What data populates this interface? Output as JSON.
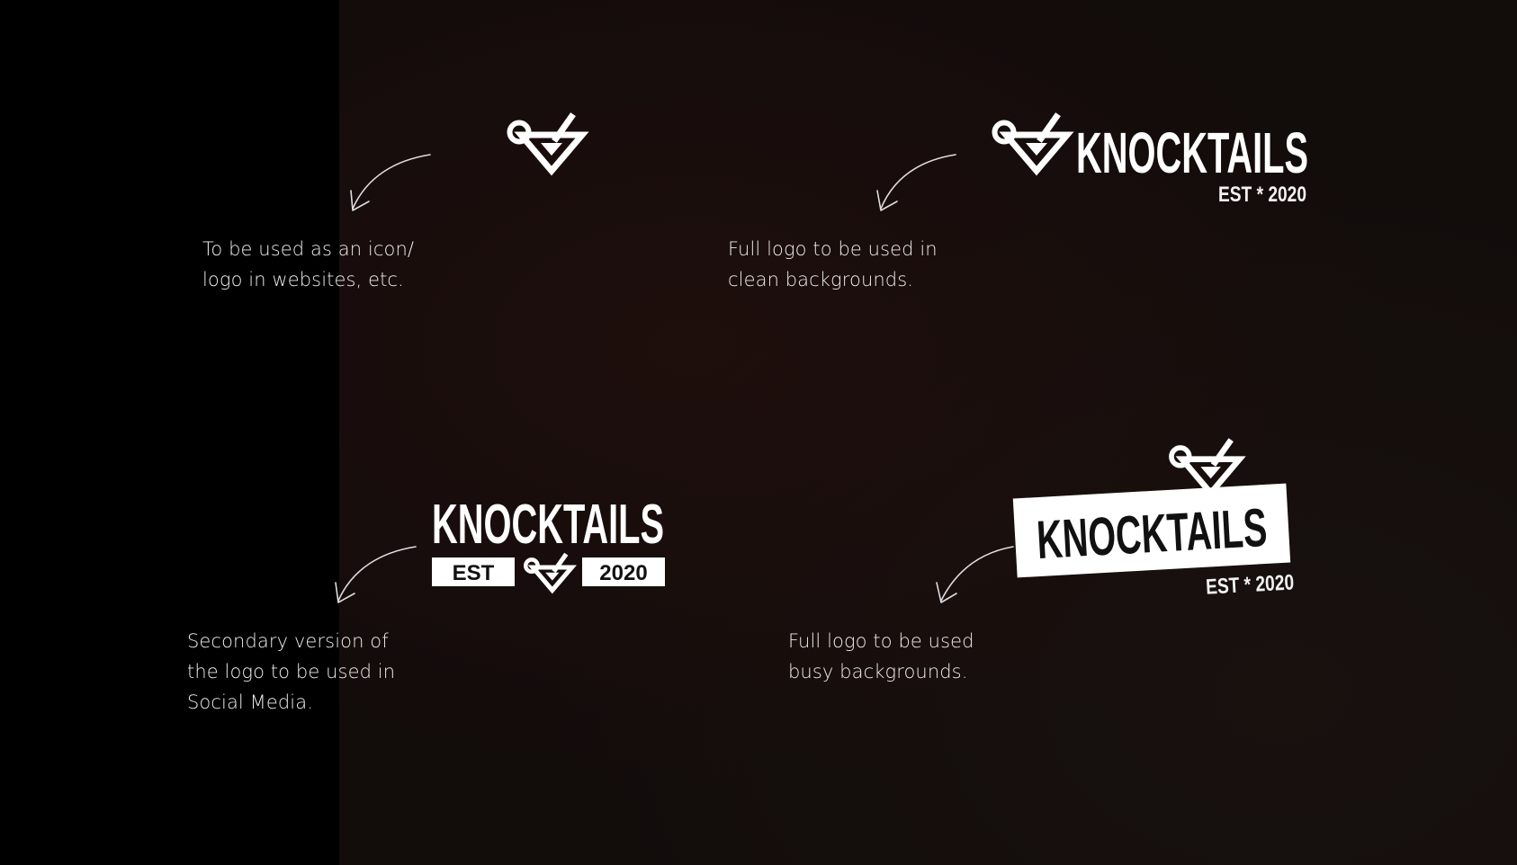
{
  "variants": [
    {
      "id": "icon",
      "caption_lines": [
        "To be used as an icon/",
        "logo in websites, etc."
      ]
    },
    {
      "id": "full-logo-clean",
      "brand": "KNOCKTAILS",
      "tagline": "EST * 2020",
      "caption_lines": [
        "Full logo to be used in",
        "clean backgrounds."
      ]
    },
    {
      "id": "secondary-logo",
      "brand": "KNOCKTAILS",
      "badge_left": "EST",
      "badge_right": "2020",
      "caption_lines": [
        "Secondary version of",
        "the logo to be used in",
        "Social Media."
      ]
    },
    {
      "id": "full-logo-busy",
      "brand": "KNOCKTAILS",
      "tagline": "EST * 2020",
      "caption_lines": [
        "Full logo to be used",
        "busy backgrounds."
      ]
    }
  ],
  "colors": {
    "left_bar": "#000000",
    "background": "#120c0b",
    "foreground": "#ffffff",
    "caption": "#ececec"
  },
  "icons": {
    "logo_mark": "cocktail-glass-icon",
    "pointer": "hand-drawn-arrow-icon"
  }
}
